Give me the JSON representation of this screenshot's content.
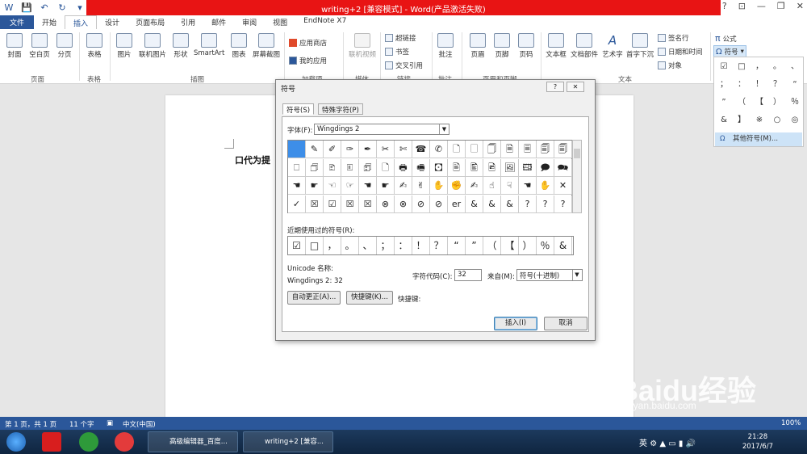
{
  "window": {
    "title": "writing+2 [兼容模式] - Word(产品激活失败)",
    "help": "?",
    "minimize": "—",
    "restore": "❐",
    "close": "✕"
  },
  "tabs": [
    "文件",
    "开始",
    "插入",
    "设计",
    "页面布局",
    "引用",
    "邮件",
    "审阅",
    "视图",
    "EndNote X7"
  ],
  "ribbon": {
    "pages": {
      "cover": "封面",
      "blank": "空白页",
      "break": "分页",
      "group": "页面"
    },
    "table": {
      "label": "表格",
      "group": "表格"
    },
    "illustrations": {
      "picture": "图片",
      "online_picture": "联机图片",
      "shapes": "形状",
      "smartart": "SmartArt",
      "chart": "图表",
      "screenshot": "屏幕截图",
      "group": "插图"
    },
    "apps": {
      "store": "应用商店",
      "my_apps": "我的应用",
      "group": "加载项"
    },
    "media": {
      "online_video": "联机视频",
      "group": "媒体"
    },
    "links": {
      "hyperlink": "超链接",
      "bookmark": "书签",
      "cross_ref": "交叉引用",
      "group": "链接"
    },
    "comments": {
      "comment": "批注",
      "group": "批注"
    },
    "header_footer": {
      "header": "页眉",
      "footer": "页脚",
      "page_num": "页码",
      "group": "页眉和页脚"
    },
    "text": {
      "textbox": "文本框",
      "quick_parts": "文档部件",
      "wordart": "艺术字",
      "dropcap": "首字下沉",
      "signature": "签名行",
      "datetime": "日期和时间",
      "object": "对象",
      "group": "文本"
    },
    "symbols": {
      "equation": "公式",
      "symbol": "符号"
    }
  },
  "symbol_panel": {
    "cells": [
      "☑",
      "□",
      "，",
      "。",
      "、",
      "；",
      "：",
      "！",
      "？",
      "“",
      "”",
      "（",
      "【",
      "）",
      "％",
      "&",
      "】",
      "※",
      "○",
      "◎"
    ],
    "more": "其他符号(M)..."
  },
  "document": {
    "text": "口代为提"
  },
  "dialog": {
    "title": "符号",
    "help": "?",
    "close": "✕",
    "tab_symbols": "符号(S)",
    "tab_special": "特殊字符(P)",
    "font_label": "字体(F):",
    "font_value": "Wingdings 2",
    "grid": [
      [
        "",
        "✎",
        "✐",
        "✑",
        "✒",
        "✂",
        "✄",
        "☎",
        "✆",
        "🗋",
        "🗌",
        "🗍",
        "🗎",
        "🗏",
        "🗐",
        "🗐"
      ],
      [
        "🗆",
        "🗇",
        "🗈",
        "🗉",
        "🗊",
        "🗋",
        "🖶",
        "🖷",
        "🖸",
        "🖹",
        "🖺",
        "🖻",
        "🖼",
        "🖽",
        "🗩",
        "🗪"
      ],
      [
        "☚",
        "☛",
        "☜",
        "☞",
        "☚",
        "☛",
        "✍",
        "✌",
        "✋",
        "✊",
        "✍",
        "☝",
        "☟",
        "☚",
        "✋",
        "✕"
      ],
      [
        "✓",
        "☒",
        "☑",
        "☒",
        "☒",
        "⊗",
        "⊗",
        "⊘",
        "⊘",
        "er",
        "&",
        "&",
        "&",
        "?",
        "?",
        "?"
      ]
    ],
    "recent_label": "近期使用过的符号(R):",
    "recent": [
      "☑",
      "□",
      "，",
      "。",
      "、",
      "；",
      "：",
      "！",
      "？",
      "“",
      "”",
      "（",
      "【",
      "）",
      "％",
      "&"
    ],
    "unicode_name_label": "Unicode 名称:",
    "unicode_name_value": "Wingdings 2: 32",
    "char_code_label": "字符代码(C):",
    "char_code_value": "32",
    "from_label": "来自(M):",
    "from_value": "符号(十进制)",
    "autocorrect": "自动更正(A)...",
    "shortcut_key_btn": "快捷键(K)...",
    "shortcut_key_label": "快捷键:",
    "insert": "插入(I)",
    "cancel": "取消"
  },
  "statusbar": {
    "page": "第 1 页，共 1 页",
    "words": "11 个字",
    "lang": "中文(中国)",
    "zoom": "100%"
  },
  "taskbar": {
    "item1": "高级编辑器_百度...",
    "item2": "writing+2 [兼容...",
    "ime": "英",
    "time": "21:28",
    "date": "2017/6/7"
  },
  "watermark": {
    "text": "Baidu经验",
    "url": "jingyan.baidu.com"
  }
}
